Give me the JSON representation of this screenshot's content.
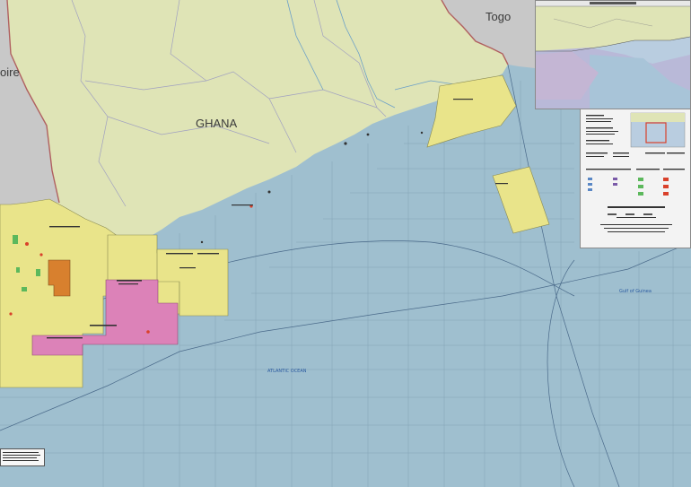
{
  "map": {
    "labels": {
      "ghana": "GHANA",
      "togo": "Togo",
      "cote_divoire": "oire",
      "atlantic_ocean": "ATLANTIC OCEAN",
      "gulf_of_guinea": "Gulf of Guinea"
    },
    "colors": {
      "ocean": "#9fbfcf",
      "land_ghana": "#dfe4b6",
      "land_neighbors": "#c8c8c8",
      "block_yellow": "#e9e48a",
      "block_pink": "#dc82b8",
      "block_orange": "#d8802e",
      "border_red": "#b06060",
      "grid_line": "#7f9fb0",
      "legend_red": "#d9412b"
    }
  }
}
